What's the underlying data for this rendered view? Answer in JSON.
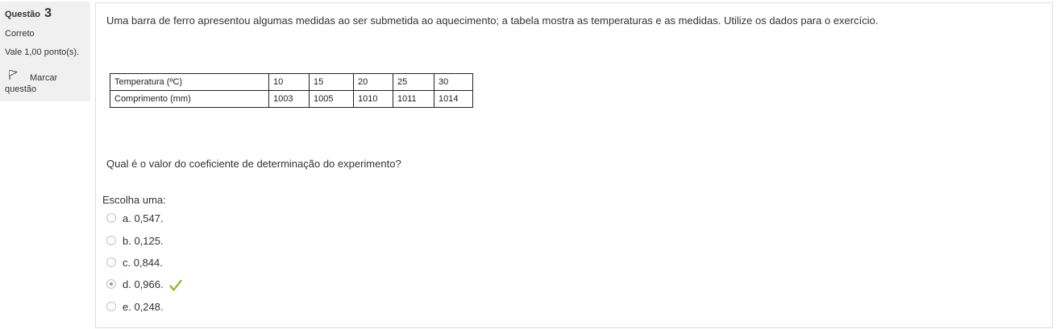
{
  "info": {
    "question_label": "Questão",
    "question_number": "3",
    "state": "Correto",
    "grade": "Vale 1,00 ponto(s).",
    "flag_label_line1": "Marcar",
    "flag_label_line2": "questão"
  },
  "question": {
    "intro": "Uma barra de ferro apresentou algumas medidas ao ser submetida ao aquecimento; a tabela mostra as temperaturas e as medidas. Utilize os dados para o exercício.",
    "table": {
      "rows": [
        {
          "header": "Temperatura (ºC)",
          "values": [
            "10",
            "15",
            "20",
            "25",
            "30"
          ]
        },
        {
          "header": "Comprimento (mm)",
          "values": [
            "1003",
            "1005",
            "1010",
            "1011",
            "1014"
          ]
        }
      ]
    },
    "text": "Qual é o valor do coeficiente de determinação do experimento?",
    "prompt": "Escolha uma:",
    "options": [
      {
        "label": "a. 0,547.",
        "selected": false,
        "correct": false
      },
      {
        "label": "b. 0,125.",
        "selected": false,
        "correct": false
      },
      {
        "label": "c. 0,844.",
        "selected": false,
        "correct": false
      },
      {
        "label": "d. 0,966.",
        "selected": true,
        "correct": true
      },
      {
        "label": "e. 0,248.",
        "selected": false,
        "correct": false
      }
    ]
  },
  "colors": {
    "correct_check": "#8bbf2e",
    "info_background": "#f0f0f0"
  }
}
